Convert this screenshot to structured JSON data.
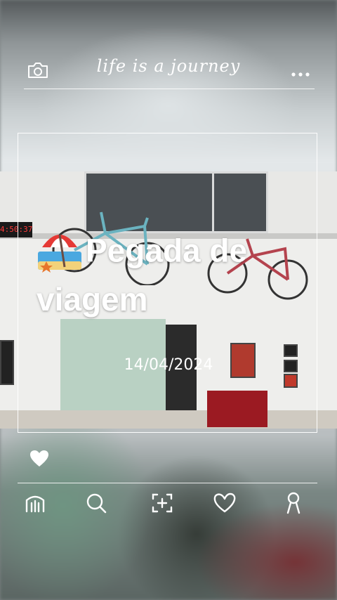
{
  "header": {
    "title": "life is a journey",
    "left_icon": "camera-icon",
    "right_icon": "more-dots-icon"
  },
  "post": {
    "title": "Pegada de viagem",
    "title_icon": "beach-umbrella-icon",
    "date": "14/04/2024",
    "clock_display": "4:50:37"
  },
  "reaction": {
    "icon": "heart-icon"
  },
  "nav": {
    "items": [
      {
        "icon": "home-icon"
      },
      {
        "icon": "search-icon"
      },
      {
        "icon": "add-post-icon"
      },
      {
        "icon": "like-icon"
      },
      {
        "icon": "profile-icon"
      }
    ]
  },
  "colors": {
    "foreground": "#ffffff"
  }
}
